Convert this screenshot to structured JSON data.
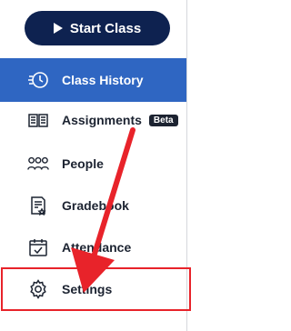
{
  "sidebar": {
    "start_button_label": "Start Class",
    "items": [
      {
        "label": "Class History",
        "icon": "class-history-icon"
      },
      {
        "label": "Assignments",
        "icon": "assignments-icon",
        "badge": "Beta"
      },
      {
        "label": "People",
        "icon": "people-icon"
      },
      {
        "label": "Gradebook",
        "icon": "gradebook-icon"
      },
      {
        "label": "Attendance",
        "icon": "attendance-icon"
      },
      {
        "label": "Settings",
        "icon": "gear-icon"
      }
    ]
  },
  "colors": {
    "primary_navy": "#0e2250",
    "active_blue": "#2f66c2",
    "annotation_red": "#e8232a"
  }
}
